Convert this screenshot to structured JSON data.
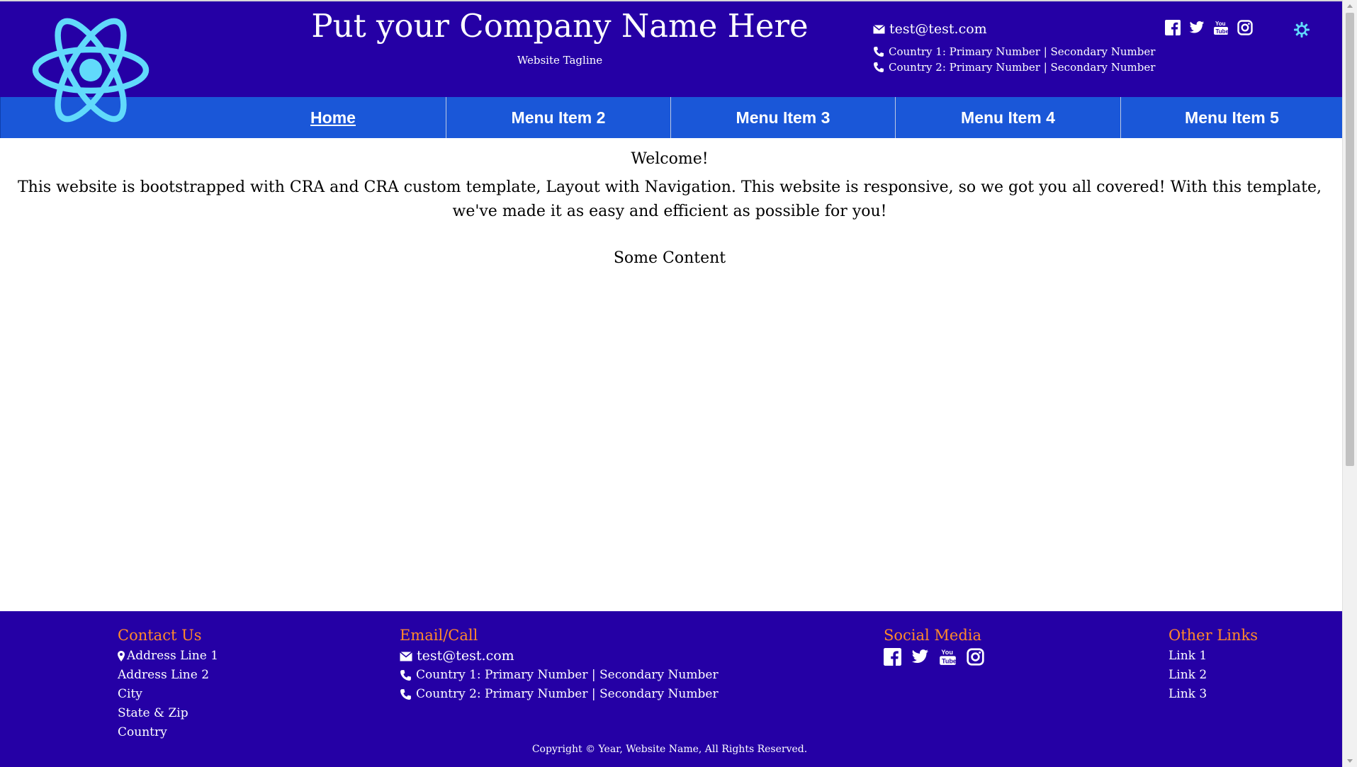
{
  "header": {
    "company_name": "Put your Company Name Here",
    "tagline": "Website Tagline",
    "email": "test@test.com",
    "phones": [
      "Country 1: Primary Number | Secondary Number",
      "Country 2: Primary Number | Secondary Number"
    ],
    "social_icons": [
      "facebook-icon",
      "twitter-icon",
      "youtube-icon",
      "instagram-icon"
    ],
    "settings_icon": "gear-icon"
  },
  "nav": {
    "items": [
      {
        "label": "Home",
        "active": true
      },
      {
        "label": "Menu Item 2",
        "active": false
      },
      {
        "label": "Menu Item 3",
        "active": false
      },
      {
        "label": "Menu Item 4",
        "active": false
      },
      {
        "label": "Menu Item 5",
        "active": false
      }
    ]
  },
  "main": {
    "welcome": "Welcome!",
    "description": "This website is bootstrapped with CRA and CRA custom template, Layout with Navigation. This website is responsive, so we got you all covered! With this template, we've made it as easy and efficient as possible for you!",
    "content": "Some Content"
  },
  "footer": {
    "contact": {
      "heading": "Contact Us",
      "lines": [
        "Address Line 1",
        "Address Line 2",
        "City",
        "State & Zip",
        "Country"
      ]
    },
    "email_call": {
      "heading": "Email/Call",
      "email": "test@test.com",
      "phones": [
        "Country 1: Primary Number | Secondary Number",
        "Country 2: Primary Number | Secondary Number"
      ]
    },
    "social": {
      "heading": "Social Media",
      "icons": [
        "facebook-icon",
        "twitter-icon",
        "youtube-icon",
        "instagram-icon"
      ]
    },
    "other_links": {
      "heading": "Other Links",
      "links": [
        "Link 1",
        "Link 2",
        "Link 3"
      ]
    },
    "copyright": "Copyright © Year,  Website Name, All Rights Reserved."
  },
  "colors": {
    "header_bg": "#2500a5",
    "nav_bg": "#1a57d8",
    "footer_heading": "#ff8a2a",
    "logo": "#61dafb"
  }
}
